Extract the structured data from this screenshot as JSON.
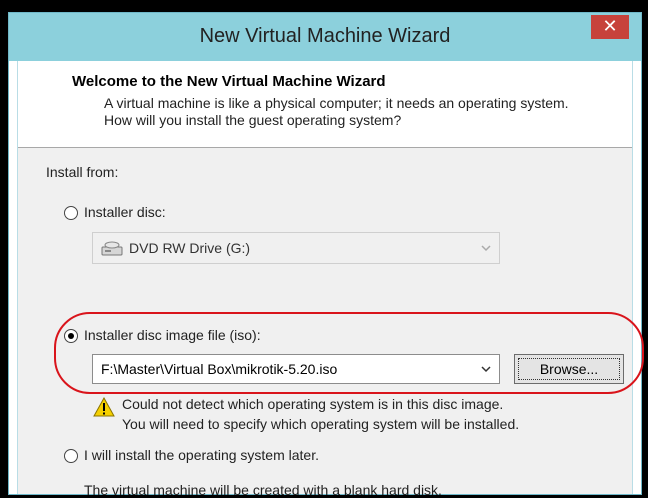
{
  "window": {
    "title": "New Virtual Machine Wizard",
    "close_label": "✕"
  },
  "header": {
    "heading": "Welcome to the New Virtual Machine Wizard",
    "description": "A virtual machine is like a physical computer; it needs an operating system. How will you install the guest operating system?"
  },
  "install_from_label": "Install from:",
  "option_disc": {
    "label": "Installer disc:",
    "selected": false
  },
  "disc_drive": {
    "value": "DVD RW Drive (G:)"
  },
  "option_iso": {
    "label": "Installer disc image file (iso):",
    "selected": true
  },
  "iso_path": {
    "value": "F:\\Master\\Virtual Box\\mikrotik-5.20.iso"
  },
  "browse_label": "Browse...",
  "warning": {
    "line1": "Could not detect which operating system is in this disc image.",
    "line2": "You will need to specify which operating system will be installed."
  },
  "option_later": {
    "label": "I will install the operating system later.",
    "selected": false
  },
  "later_note": "The virtual machine will be created with a blank hard disk.",
  "colors": {
    "titlebar": "#8cd0dc",
    "close": "#c7423b",
    "highlight": "#d9141b",
    "warning": "#f5d000"
  },
  "icons": [
    "close-icon",
    "dvd-drive-icon",
    "dropdown-arrow-icon",
    "warning-icon"
  ]
}
